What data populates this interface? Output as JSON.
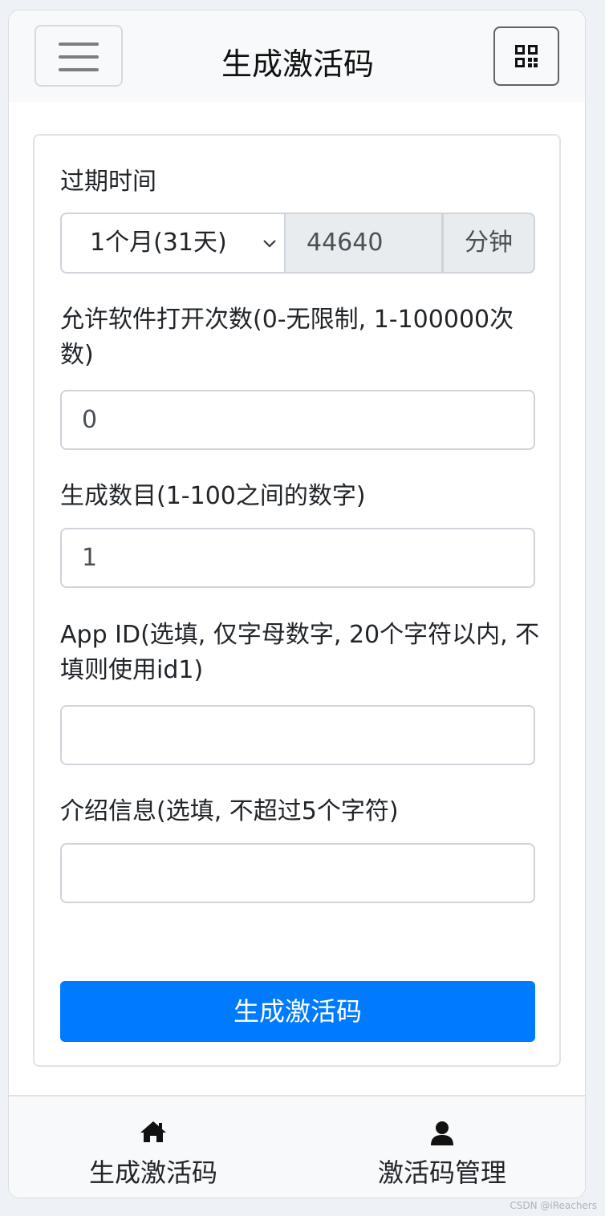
{
  "header": {
    "title": "生成激活码"
  },
  "form": {
    "expiry_label": "过期时间",
    "expiry_selected": "1个月(31天)",
    "expiry_minutes": "44640",
    "expiry_unit": "分钟",
    "open_count_label": "允许软件打开次数(0-无限制, 1-100000次数)",
    "open_count_value": "0",
    "generate_count_label": "生成数目(1-100之间的数字)",
    "generate_count_value": "1",
    "app_id_label": "App ID(选填, 仅字母数字, 20个字符以内, 不填则使用id1)",
    "app_id_value": "",
    "intro_label": "介绍信息(选填, 不超过5个字符)",
    "intro_value": "",
    "submit_label": "生成激活码"
  },
  "bottom_nav": {
    "items": [
      {
        "label": "生成激活码",
        "icon": "home-icon"
      },
      {
        "label": "激活码管理",
        "icon": "user-icon"
      }
    ]
  },
  "watermark": "CSDN @iReachers",
  "colors": {
    "primary": "#007bff",
    "bar_bg": "#f8f9fa",
    "addon_bg": "#e9ecef"
  }
}
